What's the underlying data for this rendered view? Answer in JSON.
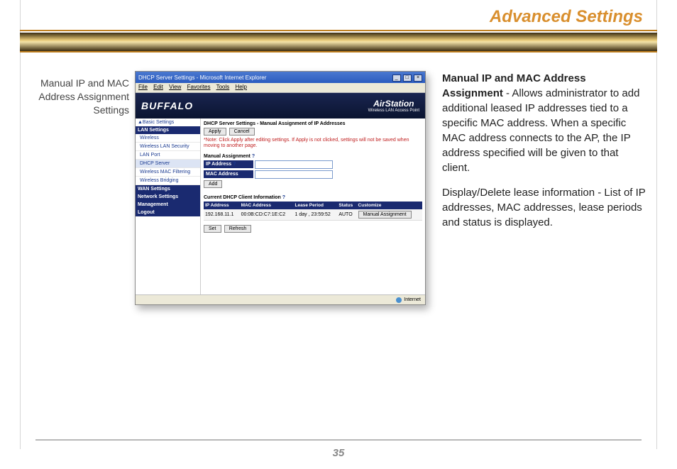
{
  "header_title": "Advanced Settings",
  "caption": "Manual IP and MAC Address Assignment Settings",
  "page_number": "35",
  "screenshot": {
    "window_title": "DHCP Server Settings - Microsoft Internet Explorer",
    "menu": [
      "File",
      "Edit",
      "View",
      "Favorites",
      "Tools",
      "Help"
    ],
    "brand_left": "BUFFALO",
    "brand_right": "AirStation",
    "brand_sub": "Wireless LAN Access Point",
    "sidebar": {
      "top": "▲Basic Settings",
      "groups": [
        {
          "header": "LAN Settings",
          "items": [
            "Wireless",
            "Wireless LAN Security",
            "LAN Port",
            "DHCP Server",
            "Wireless MAC Filtering",
            "Wireless Bridging"
          ],
          "selected": 3
        },
        {
          "header": "WAN Settings",
          "items": []
        },
        {
          "header": "Network Settings",
          "items": []
        },
        {
          "header": "Management",
          "items": []
        },
        {
          "header": "Logout",
          "items": []
        }
      ]
    },
    "main": {
      "breadcrumb": "DHCP Server Settings - Manual Assignment of IP Addresses",
      "apply": "Apply",
      "cancel": "Cancel",
      "note": "*Note: Click Apply after editing settings. If Apply is not clicked, settings will not be saved when moving to another page.",
      "manual_section": "Manual Assignment",
      "ip_label": "IP Address",
      "mac_label": "MAC Address",
      "add": "Add",
      "client_section": "Current DHCP Client Information",
      "table": {
        "headers": [
          "IP Address",
          "MAC Address",
          "Lease Period",
          "Status",
          "Customize"
        ],
        "row": {
          "ip": "192.168.11.1",
          "mac": "00:0B:CD:C7:1E:C2",
          "lease": "1 day , 23:59:52",
          "status": "AUTO",
          "customize": "Manual Assignment"
        }
      },
      "set": "Set",
      "refresh": "Refresh"
    },
    "status_text": "Internet"
  },
  "description": {
    "p1_bold": "Manual IP and MAC Address Assignment",
    "p1_rest": " - Allows administrator to add additional leased IP addresses tied to a specific MAC address.  When a specific MAC address connects to the AP, the IP address specified will be given to that client.",
    "p2": "Display/Delete lease information - List of IP addresses, MAC addresses, lease periods and status is displayed."
  }
}
